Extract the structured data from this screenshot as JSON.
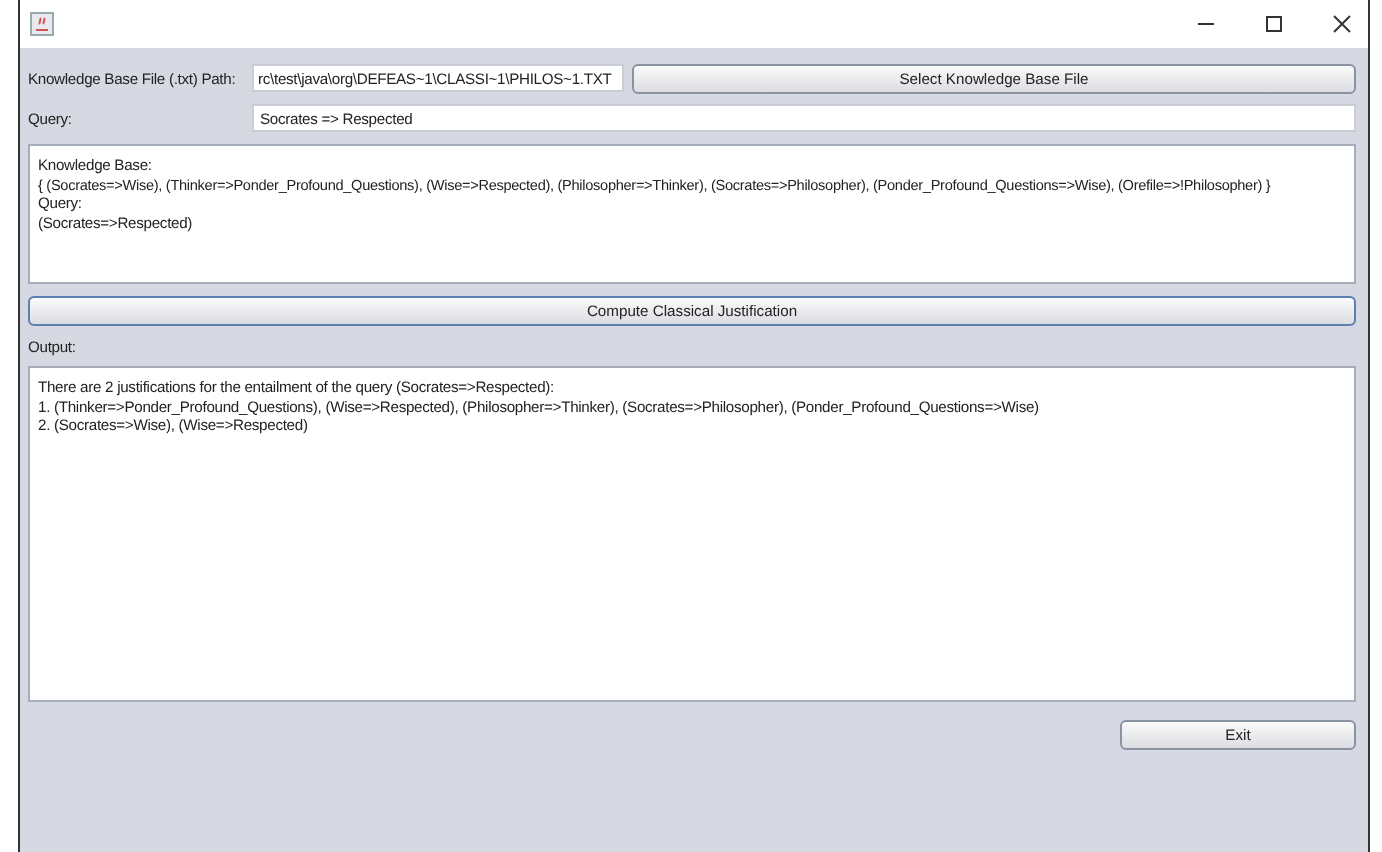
{
  "file_row": {
    "label": "Knowledge Base File (.txt) Path:",
    "value": "rc\\test\\java\\org\\DEFEAS~1\\CLASSI~1\\PHILOS~1.TXT",
    "button": "Select Knowledge Base File"
  },
  "query_row": {
    "label": "Query:",
    "value": "Socrates => Respected"
  },
  "input_area": {
    "lines": [
      "Knowledge Base:",
      "{ (Socrates=>Wise), (Thinker=>Ponder_Profound_Questions), (Wise=>Respected), (Philosopher=>Thinker), (Socrates=>Philosopher), (Ponder_Profound_Questions=>Wise), (Orefile=>!Philosopher) }",
      "Query:",
      "(Socrates=>Respected)"
    ]
  },
  "compute_button": "Compute Classical Justification",
  "output_label": "Output:",
  "output_area": {
    "lines": [
      "There are 2 justifications for the entailment of the query (Socrates=>Respected):",
      "1. (Thinker=>Ponder_Profound_Questions), (Wise=>Respected), (Philosopher=>Thinker), (Socrates=>Philosopher), (Ponder_Profound_Questions=>Wise)",
      "2. (Socrates=>Wise), (Wise=>Respected)"
    ]
  },
  "exit_button": "Exit"
}
